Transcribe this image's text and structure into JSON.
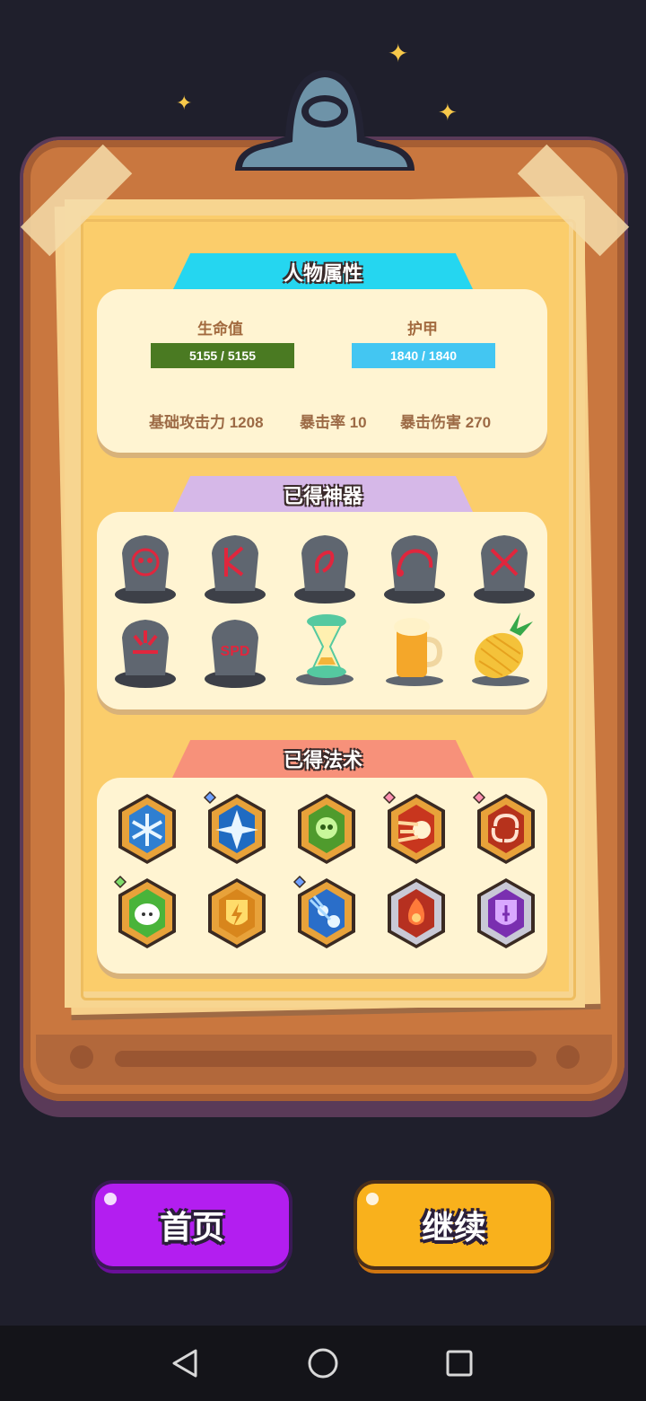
{
  "attributes": {
    "title": "人物属性",
    "hp_label": "生命值",
    "hp_value": "5155 / 5155",
    "armor_label": "护甲",
    "armor_value": "1840 / 1840",
    "base_attack": "基础攻击力 1208",
    "crit_rate": "暴击率 10",
    "crit_damage": "暴击伤害 270"
  },
  "artifacts": {
    "title": "已得神器",
    "items": [
      {
        "icon": "red-skull-rune-stone-icon"
      },
      {
        "icon": "red-k-rune-stone-icon"
      },
      {
        "icon": "red-foot-rune-stone-icon"
      },
      {
        "icon": "red-arc-rune-stone-icon"
      },
      {
        "icon": "red-cross-rune-stone-icon"
      },
      {
        "icon": "red-burst-rune-stone-icon"
      },
      {
        "icon": "spd-rune-stone-icon",
        "text": "SPD"
      },
      {
        "icon": "hourglass-icon"
      },
      {
        "icon": "beer-mug-icon"
      },
      {
        "icon": "pineapple-icon"
      }
    ]
  },
  "spells": {
    "title": "已得法术",
    "items": [
      {
        "icon": "frost-spell-icon",
        "frame": "#e8a23a",
        "inner": "#2f7fd1",
        "gem": null
      },
      {
        "icon": "star-shard-spell-icon",
        "frame": "#e8a23a",
        "inner": "#1f6bc2",
        "gem": "#6fa0ff"
      },
      {
        "icon": "poison-skull-spell-icon",
        "frame": "#e8a23a",
        "inner": "#4f9b2d",
        "gem": null
      },
      {
        "icon": "fireball-spell-icon",
        "frame": "#e8a23a",
        "inner": "#c8361e",
        "gem": "#ff8fb0"
      },
      {
        "icon": "whirlwind-spell-icon",
        "frame": "#e8a23a",
        "inner": "#b6321c",
        "gem": "#ff8fb0"
      },
      {
        "icon": "sheep-spell-icon",
        "frame": "#e8a23a",
        "inner": "#49b43a",
        "gem": "#7ddc6a"
      },
      {
        "icon": "lightning-shield-spell-icon",
        "frame": "#e8a23a",
        "inner": "#d8861c",
        "gem": null
      },
      {
        "icon": "meteor-spell-icon",
        "frame": "#e8a23a",
        "inner": "#2a6ec9",
        "gem": "#6fa0ff"
      },
      {
        "icon": "flame-burst-spell-icon",
        "frame": "#c9c9d6",
        "inner": "#b63020",
        "gem": null
      },
      {
        "icon": "purple-shield-spell-icon",
        "frame": "#c9c9d6",
        "inner": "#7a2fb0",
        "gem": null
      }
    ]
  },
  "buttons": {
    "home": "首页",
    "continue": "继续"
  },
  "colors": {
    "hp_bar": "#4a7a22",
    "armor_bar": "#43c6f2",
    "attr_banner": "#25d6f0",
    "artifact_banner": "#d6b8e8",
    "spell_banner": "#f7917a",
    "home_button": "#b31ef0",
    "continue_button": "#f9b11c"
  },
  "navbar": {
    "back": "back-icon",
    "home": "home-circle-icon",
    "recent": "recent-apps-icon"
  }
}
